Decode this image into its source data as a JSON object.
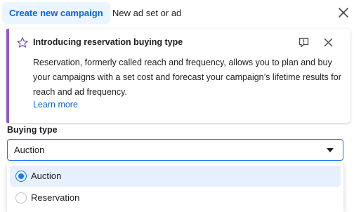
{
  "tabs": [
    {
      "label": "Create new campaign",
      "active": true
    },
    {
      "label": "New ad set or ad",
      "active": false
    }
  ],
  "icons": {
    "close": "close-icon",
    "star": "star-icon",
    "feedback": "feedback-icon",
    "caret": "caret-down-icon"
  },
  "notice": {
    "title": "Introducing reservation buying type",
    "body": "Reservation, formerly called reach and frequency, allows you to plan and buy your campaigns with a set cost and forecast your campaign’s lifetime results for reach and ad frequency.",
    "link": "Learn more"
  },
  "buying_type": {
    "label": "Buying type",
    "selected": "Auction",
    "options": [
      {
        "label": "Auction",
        "checked": true
      },
      {
        "label": "Reservation",
        "checked": false
      }
    ]
  },
  "colors": {
    "accent_blue": "#1877f2",
    "link_blue": "#0a66d8",
    "tab_active_bg": "#ebf5ff",
    "notice_accent": "#8a5cc6",
    "option_highlight": "#e7f0fd"
  }
}
